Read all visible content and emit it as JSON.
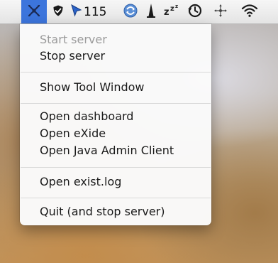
{
  "menubar": {
    "counter_text": "115",
    "icons": [
      "exist-db-icon",
      "shield-icon",
      "cursor-arrow-icon",
      "recycle-icon",
      "tower-icon",
      "sleep-zz-icon",
      "time-machine-icon",
      "move-icon",
      "wifi-icon"
    ],
    "active_color": "#3c75dc"
  },
  "menu": {
    "items": [
      {
        "label": "Start server",
        "enabled": false
      },
      {
        "label": "Stop server",
        "enabled": true
      },
      {
        "label": "Show Tool Window",
        "enabled": true
      },
      {
        "label": "Open dashboard",
        "enabled": true
      },
      {
        "label": "Open eXide",
        "enabled": true
      },
      {
        "label": "Open Java Admin Client",
        "enabled": true
      },
      {
        "label": "Open exist.log",
        "enabled": true
      },
      {
        "label": "Quit (and stop server)",
        "enabled": true
      }
    ]
  }
}
